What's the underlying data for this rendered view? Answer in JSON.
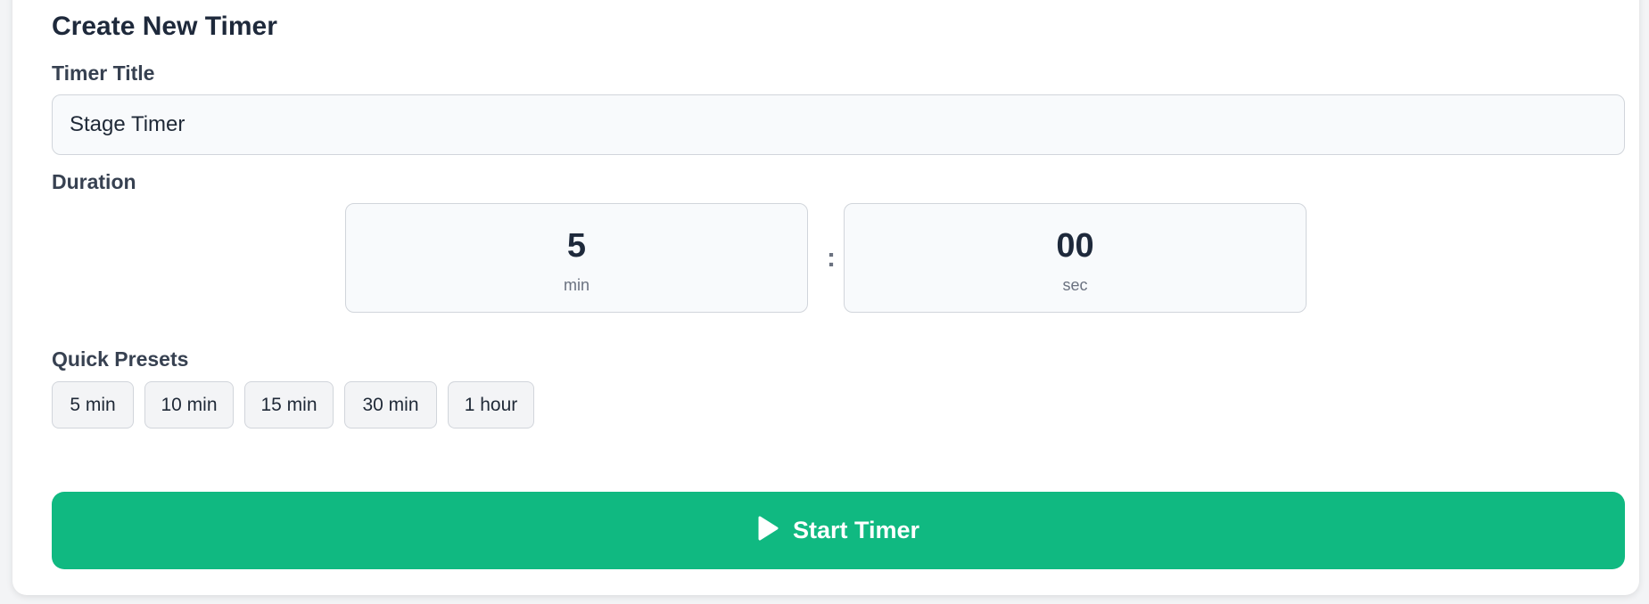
{
  "form": {
    "heading": "Create New Timer",
    "title_label": "Timer Title",
    "title_value": "Stage Timer",
    "duration_label": "Duration",
    "minutes_value": "5",
    "minutes_unit": "min",
    "separator": ":",
    "seconds_value": "00",
    "seconds_unit": "sec",
    "presets_label": "Quick Presets",
    "presets": [
      "5 min",
      "10 min",
      "15 min",
      "30 min",
      "1 hour"
    ],
    "start_label": "Start Timer",
    "start_icon": "play-icon"
  },
  "colors": {
    "accent": "#10b981",
    "heading": "#1e293b",
    "muted": "#6b7280"
  }
}
